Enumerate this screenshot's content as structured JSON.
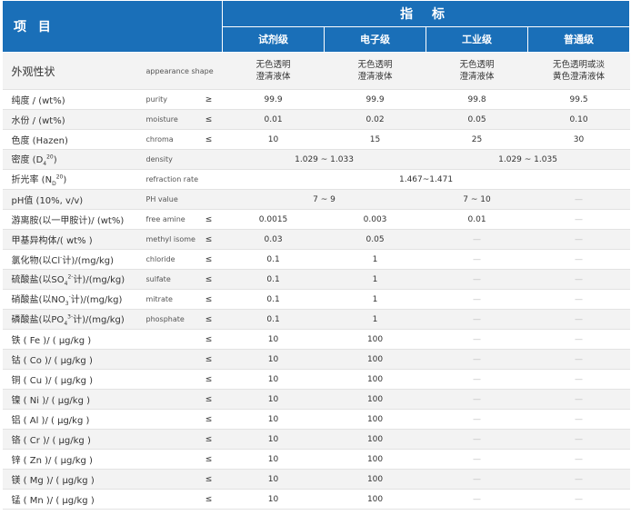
{
  "header": {
    "item": "项 目",
    "indicator": "指 标",
    "grades": [
      "试剂级",
      "电子级",
      "工业级",
      "普通级"
    ]
  },
  "rows": {
    "appearance": {
      "cn": "外观性状",
      "en": "appearance shape",
      "v1": "无色透明\n澄清液体",
      "v2": "无色透明\n澄清液体",
      "v3": "无色透明\n澄清液体",
      "v4": "无色透明或淡\n黄色澄清液体"
    },
    "purity": {
      "cn": "纯度 / (wt%)",
      "en": "purity",
      "op": "≥",
      "v1": "99.9",
      "v2": "99.9",
      "v3": "99.8",
      "v4": "99.5"
    },
    "moisture": {
      "cn": "水份 / (wt%)",
      "en": "moisture",
      "op": "≤",
      "v1": "0.01",
      "v2": "0.02",
      "v3": "0.05",
      "v4": "0.10"
    },
    "chroma": {
      "cn": "色度 (Hazen)",
      "en": "chroma",
      "op": "≤",
      "v1": "10",
      "v2": "15",
      "v3": "25",
      "v4": "30"
    },
    "density": {
      "cn_a": "密度 (D",
      "cn_sub": "4",
      "cn_sup": "20",
      "cn_b": ")",
      "en": "density",
      "v12": "1.029 ~ 1.033",
      "v34": "1.029 ~ 1.035"
    },
    "refraction": {
      "cn_a": "折光率 (N",
      "cn_sub": "D",
      "cn_sup": "20",
      "cn_b": ")",
      "en": "refraction rate",
      "vall": "1.467~1.471"
    },
    "ph": {
      "cn": "pH值 (10%, v/v)",
      "en": "PH value",
      "v12": "7 ~ 9",
      "v3": "7 ~ 10",
      "v4": "—"
    },
    "amine": {
      "cn": "游离胺(以一甲胺计)/ (wt%)",
      "en": "free amine",
      "op": "≤",
      "v1": "0.0015",
      "v2": "0.003",
      "v3": "0.01",
      "v4": "—"
    },
    "isomer": {
      "cn": "甲基异构体/( wt% )",
      "en": "methyl isomer",
      "op": "≤",
      "v1": "0.03",
      "v2": "0.05",
      "v3": "—",
      "v4": "—"
    },
    "chloride": {
      "cn_a": "氯化物(以Cl",
      "cn_sup": "-",
      "cn_b": "计)/(mg/kg)",
      "en": "chloride",
      "op": "≤",
      "v1": "0.1",
      "v2": "1",
      "v3": "—",
      "v4": "—"
    },
    "sulfate": {
      "cn_a": "硫酸盐(以SO",
      "cn_sub": "4",
      "cn_sup": "2-",
      "cn_b": "计)/(mg/kg)",
      "en": "sulfate",
      "op": "≤",
      "v1": "0.1",
      "v2": "1",
      "v3": "—",
      "v4": "—"
    },
    "nitrate": {
      "cn_a": "硝酸盐(以NO",
      "cn_sub": "3",
      "cn_sup": "-",
      "cn_b": "计)/(mg/kg)",
      "en": "mitrate",
      "op": "≤",
      "v1": "0.1",
      "v2": "1",
      "v3": "—",
      "v4": "—"
    },
    "phosphate": {
      "cn_a": "磷酸盐(以PO",
      "cn_sub": "4",
      "cn_sup": "3-",
      "cn_b": "计)/(mg/kg)",
      "en": "phosphate",
      "op": "≤",
      "v1": "0.1",
      "v2": "1",
      "v3": "—",
      "v4": "—"
    },
    "fe": {
      "cn": "铁 ( Fe )/ ( μg/kg )",
      "op": "≤",
      "v1": "10",
      "v2": "100",
      "v3": "—",
      "v4": "—"
    },
    "co": {
      "cn": "钴 ( Co )/ ( μg/kg )",
      "op": "≤",
      "v1": "10",
      "v2": "100",
      "v3": "—",
      "v4": "—"
    },
    "cu": {
      "cn": "铜 ( Cu )/ ( μg/kg )",
      "op": "≤",
      "v1": "10",
      "v2": "100",
      "v3": "—",
      "v4": "—"
    },
    "ni": {
      "cn": "镍 ( Ni )/ ( μg/kg )",
      "op": "≤",
      "v1": "10",
      "v2": "100",
      "v3": "—",
      "v4": "—"
    },
    "al": {
      "cn": "铝 ( Al )/ ( μg/kg )",
      "op": "≤",
      "v1": "10",
      "v2": "100",
      "v3": "—",
      "v4": "—"
    },
    "cr": {
      "cn": "铬 ( Cr )/ ( μg/kg )",
      "op": "≤",
      "v1": "10",
      "v2": "100",
      "v3": "—",
      "v4": "—"
    },
    "zn": {
      "cn": "锌 ( Zn )/ ( μg/kg )",
      "op": "≤",
      "v1": "10",
      "v2": "100",
      "v3": "—",
      "v4": "—"
    },
    "mg": {
      "cn": "镁 ( Mg )/ ( μg/kg )",
      "op": "≤",
      "v1": "10",
      "v2": "100",
      "v3": "—",
      "v4": "—"
    },
    "mn": {
      "cn": "锰 ( Mn )/ ( μg/kg )",
      "op": "≤",
      "v1": "10",
      "v2": "100",
      "v3": "—",
      "v4": "—"
    }
  }
}
